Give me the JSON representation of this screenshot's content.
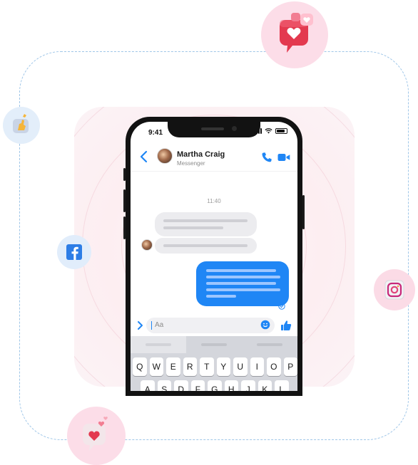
{
  "phone": {
    "status_time": "9:41",
    "contact": {
      "name": "Martha Craig",
      "subtitle": "Messenger"
    },
    "timestamp": "11:40",
    "composer_placeholder": "Aa",
    "keyboard_row_1": [
      "Q",
      "W",
      "E",
      "R",
      "T",
      "Y",
      "U",
      "I",
      "O",
      "P"
    ],
    "keyboard_row_2": [
      "A",
      "S",
      "D",
      "F",
      "G",
      "H",
      "J",
      "K",
      "L"
    ]
  },
  "colors": {
    "messenger_blue": "#1f86f5",
    "incoming_bubble": "#ececef",
    "dashed_frame": "#9fc6e8",
    "pink_badge": "#fcdde8",
    "facebook_blue": "#2d7de6"
  },
  "floating_icons": [
    "heart-like-notification-icon",
    "hand-wave-icon",
    "facebook-icon",
    "instagram-icon",
    "heart-bubble-icon"
  ]
}
